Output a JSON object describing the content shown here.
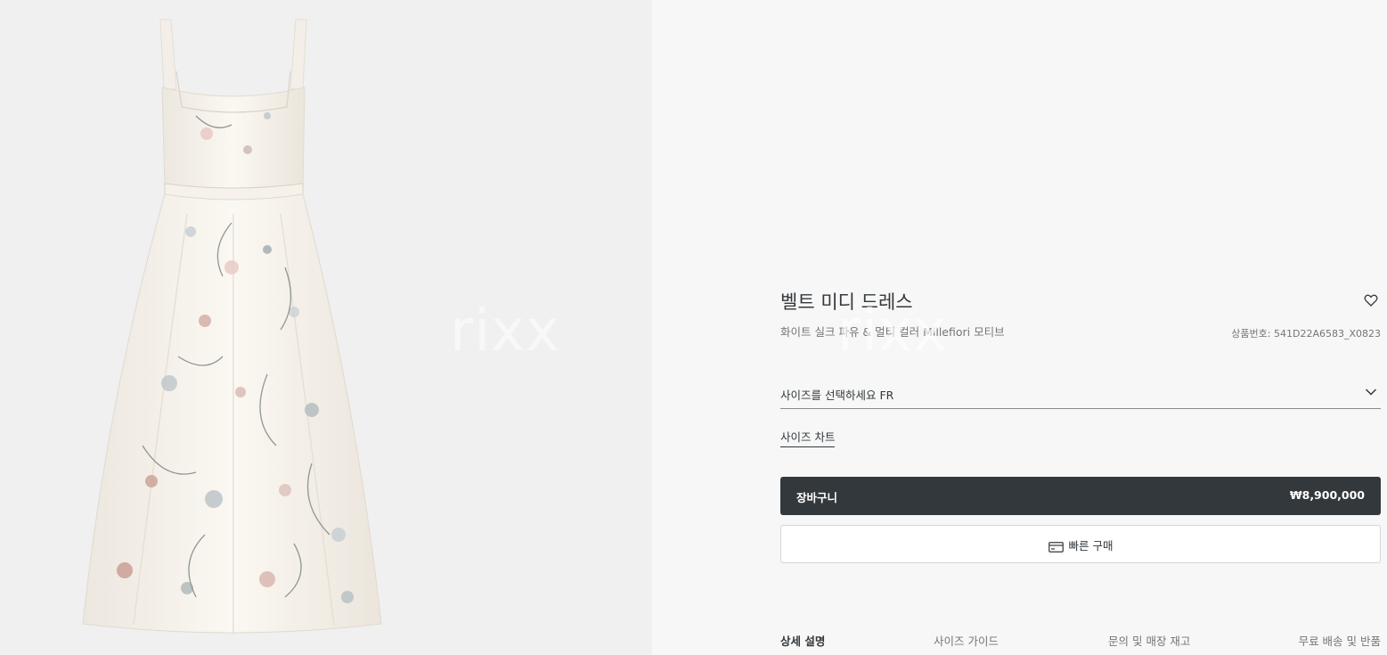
{
  "product": {
    "title": "벨트 미디 드레스",
    "subtitle": "화이트 실크 파유 & 멀티 컬러 Millefiori 모티브",
    "reference": "상품번호: 541D22A6583_X0823",
    "watermark": "rixx"
  },
  "size": {
    "select_label": "사이즈를 선택하세요 FR",
    "chart_link": "사이즈 차트"
  },
  "actions": {
    "add_to_cart": "장바구니",
    "price": "₩8,900,000",
    "quick_buy": "빠른 구매"
  },
  "tabs": [
    {
      "label": "상세 설명",
      "active": true
    },
    {
      "label": "사이즈 가이드",
      "active": false
    },
    {
      "label": "문의 및 매장 재고",
      "active": false
    },
    {
      "label": "무료 배송 및 반품",
      "active": false
    }
  ],
  "icons": {
    "wishlist": "heart-outline-icon",
    "size_dropdown": "chevron-down-icon",
    "quick_buy": "credit-card-icon"
  },
  "colors": {
    "page_background": "#f7f7f7",
    "image_background": "#f0f0f0",
    "primary_button": "#33383c",
    "text_primary": "#33383c",
    "text_secondary": "#757575"
  }
}
